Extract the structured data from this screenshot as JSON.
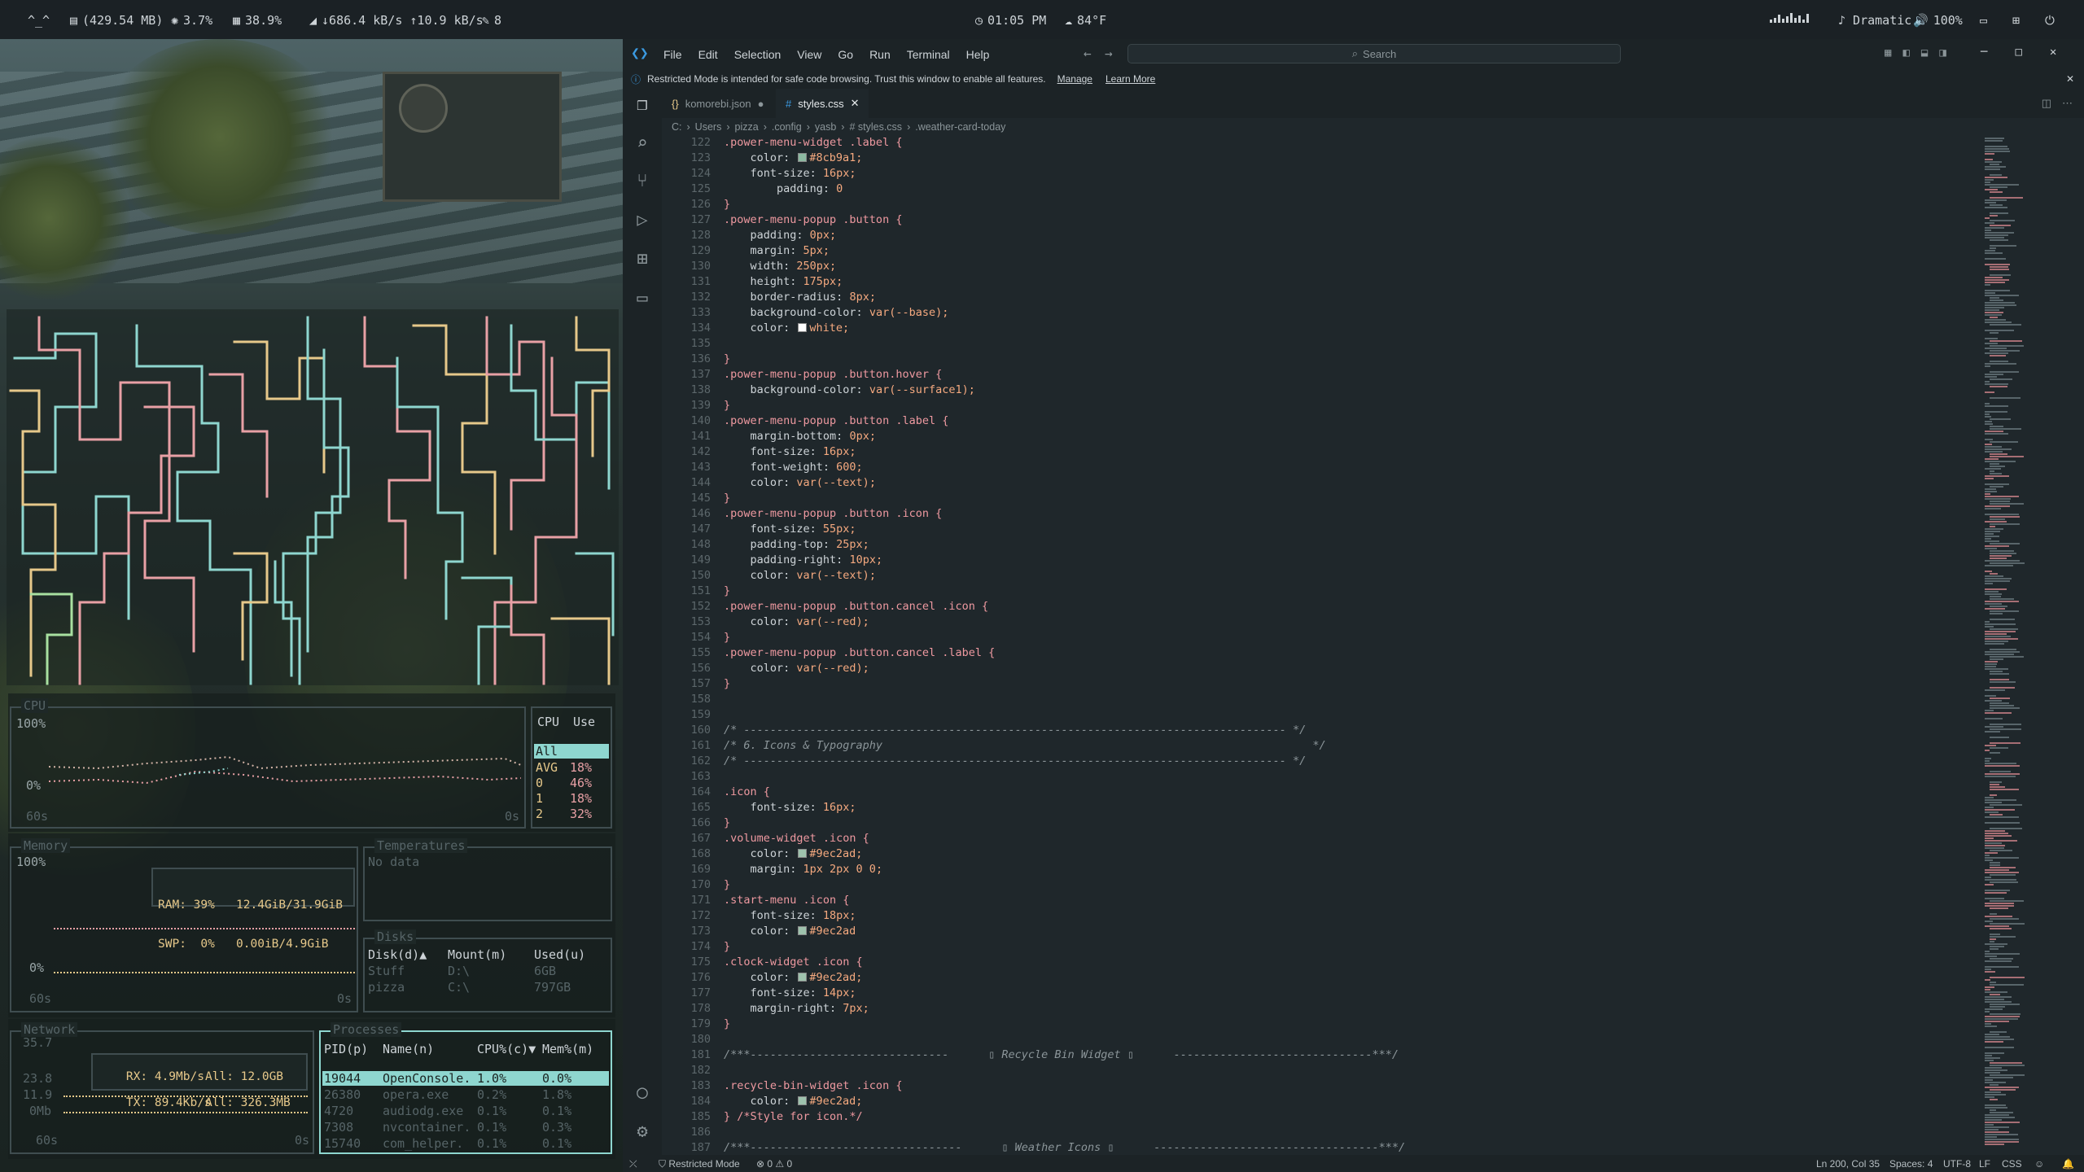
{
  "topbar": {
    "launcher": "^_^",
    "disk": "(429.54 MB)",
    "cpu": "3.7%",
    "ram": "38.9%",
    "network": "↓686.4 kB/s ↑10.9 kB/s",
    "edit_count": "8",
    "time": "01:05 PM",
    "weather": "84°F",
    "media": "♪ Dramatic",
    "volume": "100%"
  },
  "btop": {
    "cpu": {
      "title": "CPU",
      "y_top": "100%",
      "y_bottom": "0%",
      "x_left": "60s",
      "x_right": "0s",
      "table_header": [
        "CPU",
        "Use"
      ],
      "rows": [
        {
          "name": "All",
          "value": ""
        },
        {
          "name": "AVG",
          "value": "18%"
        },
        {
          "name": "0",
          "value": "46%"
        },
        {
          "name": "1",
          "value": "18%"
        },
        {
          "name": "2",
          "value": "32%"
        }
      ]
    },
    "memory": {
      "title": "Memory",
      "y_top": "100%",
      "y_bottom": "0%",
      "x_left": "60s",
      "x_right": "0s",
      "ram": "RAM: 39%   12.4GiB/31.9GiB",
      "swp": "SWP:  0%   0.00iB/4.9GiB"
    },
    "temps": {
      "title": "Temperatures",
      "body": "No data"
    },
    "disks": {
      "title": "Disks",
      "headers": [
        "Disk(d)▲",
        "Mount(m)",
        "Used(u)"
      ],
      "rows": [
        [
          "Stuff",
          "D:\\",
          "6GB"
        ],
        [
          "pizza",
          "C:\\",
          "797GB"
        ]
      ]
    },
    "network": {
      "title": "Network",
      "y_vals": [
        "35.7",
        "23.8",
        "11.9",
        "0Mb"
      ],
      "rx": "RX: 4.9Mb/s",
      "rx_all": "All: 12.0GB",
      "tx": "TX: 89.4Kb/s",
      "tx_all": "All: 326.3MB",
      "x_left": "60s",
      "x_right": "0s"
    },
    "processes": {
      "title": "Processes",
      "headers": [
        "PID(p)",
        "Name(n)",
        "CPU%(c)▼",
        "Mem%(m)"
      ],
      "rows": [
        [
          "19044",
          "OpenConsole.",
          "1.0%",
          "0.0%"
        ],
        [
          "26380",
          "opera.exe",
          "0.2%",
          "1.8%"
        ],
        [
          "4720",
          "audiodg.exe",
          "0.1%",
          "0.1%"
        ],
        [
          "7308",
          "nvcontainer.",
          "0.1%",
          "0.3%"
        ],
        [
          "15740",
          "com_helper.",
          "0.1%",
          "0.1%"
        ]
      ]
    }
  },
  "vscode": {
    "menu": [
      "File",
      "Edit",
      "Selection",
      "View",
      "Go",
      "Run",
      "Terminal",
      "Help"
    ],
    "search_placeholder": "Search",
    "notice": "Restricted Mode is intended for safe code browsing. Trust this window to enable all features.",
    "notice_manage": "Manage",
    "notice_learn": "Learn More",
    "tabs": [
      {
        "label": "komorebi.json",
        "icon": "{}"
      },
      {
        "label": "styles.css",
        "icon": "#"
      }
    ],
    "breadcrumbs": [
      "C:",
      "Users",
      "pizza",
      ".config",
      "yasb",
      "# styles.css",
      ".weather-card-today"
    ],
    "status": {
      "mode": "Restricted Mode",
      "problems": "⊗ 0 ⚠ 0",
      "position": "Ln 200, Col 35",
      "spaces": "Spaces: 4",
      "encoding": "UTF-8",
      "eol": "LF",
      "language": "CSS"
    },
    "code": [
      {
        "n": "122",
        "t": ".power-menu-widget .label {",
        "k": "sel"
      },
      {
        "n": "123",
        "t": "    color: ■#8cb9a1;",
        "k": "prop",
        "sw": "#8cb9a1"
      },
      {
        "n": "124",
        "t": "    font-size: 16px;",
        "k": "prop"
      },
      {
        "n": "125",
        "t": "        padding: 0",
        "k": "prop"
      },
      {
        "n": "126",
        "t": "}",
        "k": "sel"
      },
      {
        "n": "127",
        "t": ".power-menu-popup .button {",
        "k": "sel"
      },
      {
        "n": "128",
        "t": "    padding: 0px;",
        "k": "prop"
      },
      {
        "n": "129",
        "t": "    margin: 5px;",
        "k": "prop"
      },
      {
        "n": "130",
        "t": "    width: 250px;",
        "k": "prop"
      },
      {
        "n": "131",
        "t": "    height: 175px;",
        "k": "prop"
      },
      {
        "n": "132",
        "t": "    border-radius: 8px;",
        "k": "prop"
      },
      {
        "n": "133",
        "t": "    background-color: var(--base);",
        "k": "prop"
      },
      {
        "n": "134",
        "t": "    color: ■white;",
        "k": "prop",
        "sw": "#ffffff"
      },
      {
        "n": "135",
        "t": "",
        "k": "prop"
      },
      {
        "n": "136",
        "t": "}",
        "k": "sel"
      },
      {
        "n": "137",
        "t": ".power-menu-popup .button.hover {",
        "k": "sel"
      },
      {
        "n": "138",
        "t": "    background-color: var(--surface1);",
        "k": "prop"
      },
      {
        "n": "139",
        "t": "}",
        "k": "sel"
      },
      {
        "n": "140",
        "t": ".power-menu-popup .button .label {",
        "k": "sel"
      },
      {
        "n": "141",
        "t": "    margin-bottom: 0px;",
        "k": "prop"
      },
      {
        "n": "142",
        "t": "    font-size: 16px;",
        "k": "prop"
      },
      {
        "n": "143",
        "t": "    font-weight: 600;",
        "k": "prop"
      },
      {
        "n": "144",
        "t": "    color: var(--text);",
        "k": "prop"
      },
      {
        "n": "145",
        "t": "}",
        "k": "sel"
      },
      {
        "n": "146",
        "t": ".power-menu-popup .button .icon {",
        "k": "sel"
      },
      {
        "n": "147",
        "t": "    font-size: 55px;",
        "k": "prop"
      },
      {
        "n": "148",
        "t": "    padding-top: 25px;",
        "k": "prop"
      },
      {
        "n": "149",
        "t": "    padding-right: 10px;",
        "k": "prop"
      },
      {
        "n": "150",
        "t": "    color: var(--text);",
        "k": "prop"
      },
      {
        "n": "151",
        "t": "}",
        "k": "sel"
      },
      {
        "n": "152",
        "t": ".power-menu-popup .button.cancel .icon {",
        "k": "sel"
      },
      {
        "n": "153",
        "t": "    color: var(--red);",
        "k": "prop"
      },
      {
        "n": "154",
        "t": "}",
        "k": "sel"
      },
      {
        "n": "155",
        "t": ".power-menu-popup .button.cancel .label {",
        "k": "sel"
      },
      {
        "n": "156",
        "t": "    color: var(--red);",
        "k": "prop"
      },
      {
        "n": "157",
        "t": "}",
        "k": "sel"
      },
      {
        "n": "158",
        "t": "",
        "k": "prop"
      },
      {
        "n": "159",
        "t": "",
        "k": "prop"
      },
      {
        "n": "160",
        "t": "/* ---------------------------------------------------------------------------------- */",
        "k": "cmt"
      },
      {
        "n": "161",
        "t": "/* 6. Icons & Typography                                                                 */",
        "k": "cmt"
      },
      {
        "n": "162",
        "t": "/* ---------------------------------------------------------------------------------- */",
        "k": "cmt"
      },
      {
        "n": "163",
        "t": "",
        "k": "prop"
      },
      {
        "n": "164",
        "t": ".icon {",
        "k": "sel"
      },
      {
        "n": "165",
        "t": "    font-size: 16px;",
        "k": "prop"
      },
      {
        "n": "166",
        "t": "}",
        "k": "sel"
      },
      {
        "n": "167",
        "t": ".volume-widget .icon {",
        "k": "sel"
      },
      {
        "n": "168",
        "t": "    color: ■#9ec2ad;",
        "k": "prop",
        "sw": "#9ec2ad"
      },
      {
        "n": "169",
        "t": "    margin: 1px 2px 0 0;",
        "k": "prop"
      },
      {
        "n": "170",
        "t": "}",
        "k": "sel"
      },
      {
        "n": "171",
        "t": ".start-menu .icon {",
        "k": "sel"
      },
      {
        "n": "172",
        "t": "    font-size: 18px;",
        "k": "prop"
      },
      {
        "n": "173",
        "t": "    color: ■#9ec2ad",
        "k": "prop",
        "sw": "#9ec2ad"
      },
      {
        "n": "174",
        "t": "}",
        "k": "sel"
      },
      {
        "n": "175",
        "t": ".clock-widget .icon {",
        "k": "sel"
      },
      {
        "n": "176",
        "t": "    color: ■#9ec2ad;",
        "k": "prop",
        "sw": "#9ec2ad"
      },
      {
        "n": "177",
        "t": "    font-size: 14px;",
        "k": "prop"
      },
      {
        "n": "178",
        "t": "    margin-right: 7px;",
        "k": "prop"
      },
      {
        "n": "179",
        "t": "}",
        "k": "sel"
      },
      {
        "n": "180",
        "t": "",
        "k": "prop"
      },
      {
        "n": "181",
        "t": "/***------------------------------      ▯ Recycle Bin Widget ▯      ------------------------------***/",
        "k": "cmt"
      },
      {
        "n": "182",
        "t": "",
        "k": "prop"
      },
      {
        "n": "183",
        "t": ".recycle-bin-widget .icon {",
        "k": "sel"
      },
      {
        "n": "184",
        "t": "    color: ■#9ec2ad;",
        "k": "prop",
        "sw": "#9ec2ad"
      },
      {
        "n": "185",
        "t": "} /*Style for icon.*/",
        "k": "sel"
      },
      {
        "n": "186",
        "t": "",
        "k": "prop"
      },
      {
        "n": "187",
        "t": "/***--------------------------------      ▯ Weather Icons ▯      ----------------------------------***/",
        "k": "cmt"
      }
    ]
  },
  "colors": {
    "cyan": "#8ed6cf",
    "pink": "#e8a0a5",
    "yellow": "#e6c88a",
    "selector": "#ee99a0",
    "number": "#f5a97f"
  }
}
